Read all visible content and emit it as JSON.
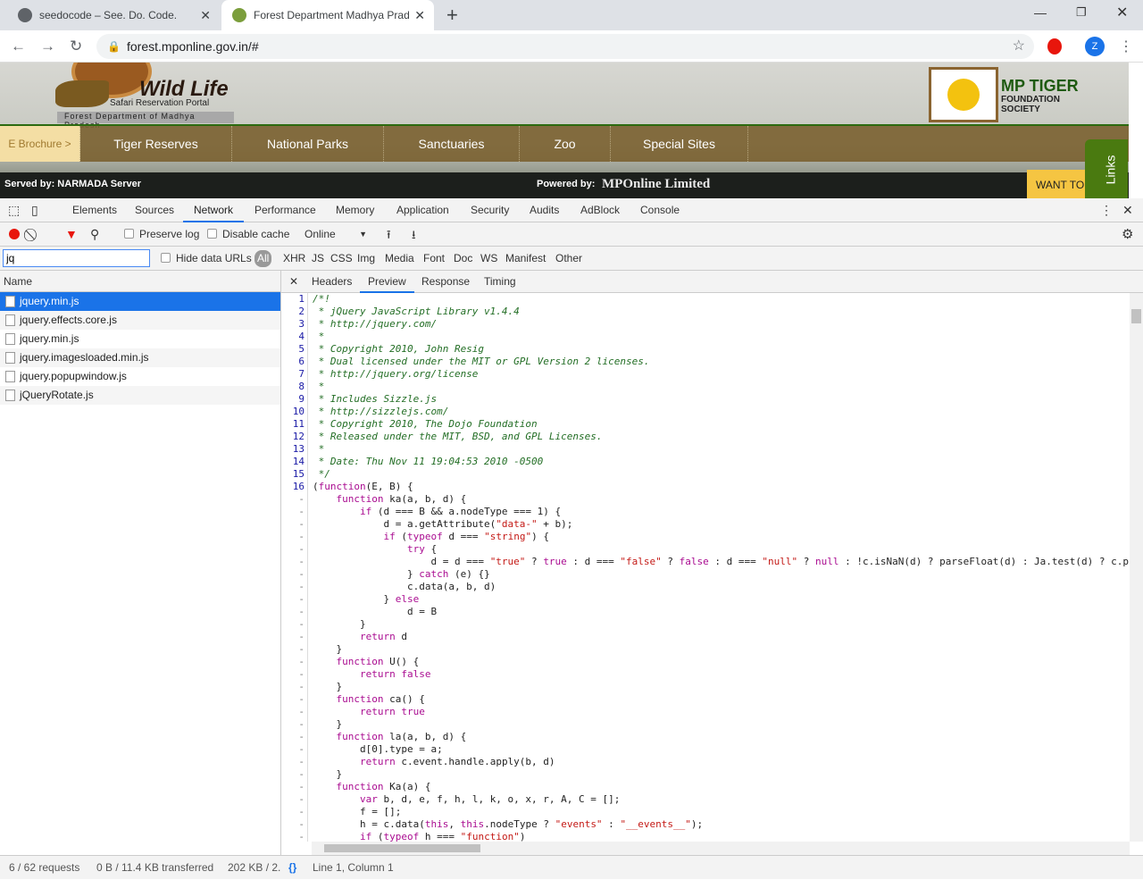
{
  "browser": {
    "tabs": [
      {
        "title": "seedocode – See. Do. Code."
      },
      {
        "title": "Forest Department Madhya Prad"
      }
    ],
    "url": "forest.mponline.gov.in/#",
    "profile": "Z"
  },
  "site": {
    "logo_title": "Wild Life",
    "logo_sub": "Safari Reservation Portal",
    "dept": "Forest Department of Madhya Pradesh",
    "tiger_title": "MP TIGER",
    "tiger_sub1": "FOUNDATION",
    "tiger_sub2": "SOCIETY",
    "nav": [
      "E Brochure >",
      "Tiger Reserves",
      "National Parks",
      "Sanctuaries",
      "Zoo",
      "Special Sites"
    ],
    "served": "Served by: NARMADA Server",
    "powered": "Powered by:",
    "powered_logo": "MPOnline Limited",
    "want": "WANT TO",
    "links": "Links"
  },
  "devtools": {
    "tabs": [
      "Elements",
      "Sources",
      "Network",
      "Performance",
      "Memory",
      "Application",
      "Security",
      "Audits",
      "AdBlock",
      "Console"
    ],
    "active_tab": "Network",
    "toolbar": {
      "preserve_log": "Preserve log",
      "disable_cache": "Disable cache",
      "throttle": "Online"
    },
    "filter": {
      "value": "jq",
      "hide_data_urls": "Hide data URLs",
      "types": [
        "All",
        "XHR",
        "JS",
        "CSS",
        "Img",
        "Media",
        "Font",
        "Doc",
        "WS",
        "Manifest",
        "Other"
      ]
    },
    "name_header": "Name",
    "files": [
      "jquery.min.js",
      "jquery.effects.core.js",
      "jquery.min.js",
      "jquery.imagesloaded.min.js",
      "jquery.popupwindow.js",
      "jQueryRotate.js"
    ],
    "detail_tabs": [
      "Headers",
      "Preview",
      "Response",
      "Timing"
    ],
    "code": [
      [
        "1",
        "/*!"
      ],
      [
        "2",
        " * jQuery JavaScript Library v1.4.4"
      ],
      [
        "3",
        " * http://jquery.com/"
      ],
      [
        "4",
        " *"
      ],
      [
        "5",
        " * Copyright 2010, John Resig"
      ],
      [
        "6",
        " * Dual licensed under the MIT or GPL Version 2 licenses."
      ],
      [
        "7",
        " * http://jquery.org/license"
      ],
      [
        "8",
        " *"
      ],
      [
        "9",
        " * Includes Sizzle.js"
      ],
      [
        "10",
        " * http://sizzlejs.com/"
      ],
      [
        "11",
        " * Copyright 2010, The Dojo Foundation"
      ],
      [
        "12",
        " * Released under the MIT, BSD, and GPL Licenses."
      ],
      [
        "13",
        " *"
      ],
      [
        "14",
        " * Date: Thu Nov 11 19:04:53 2010 -0500"
      ],
      [
        "15",
        " */"
      ],
      [
        "16",
        "(function(E, B) {"
      ],
      [
        "-",
        "    function ka(a, b, d) {"
      ],
      [
        "-",
        "        if (d === B && a.nodeType === 1) {"
      ],
      [
        "-",
        "            d = a.getAttribute(\"data-\" + b);"
      ],
      [
        "-",
        "            if (typeof d === \"string\") {"
      ],
      [
        "-",
        "                try {"
      ],
      [
        "-",
        "                    d = d === \"true\" ? true : d === \"false\" ? false : d === \"null\" ? null : !c.isNaN(d) ? parseFloat(d) : Ja.test(d) ? c.p"
      ],
      [
        "-",
        "                } catch (e) {}"
      ],
      [
        "-",
        "                c.data(a, b, d)"
      ],
      [
        "-",
        "            } else"
      ],
      [
        "-",
        "                d = B"
      ],
      [
        "-",
        "        }"
      ],
      [
        "-",
        "        return d"
      ],
      [
        "-",
        "    }"
      ],
      [
        "-",
        "    function U() {"
      ],
      [
        "-",
        "        return false"
      ],
      [
        "-",
        "    }"
      ],
      [
        "-",
        "    function ca() {"
      ],
      [
        "-",
        "        return true"
      ],
      [
        "-",
        "    }"
      ],
      [
        "-",
        "    function la(a, b, d) {"
      ],
      [
        "-",
        "        d[0].type = a;"
      ],
      [
        "-",
        "        return c.event.handle.apply(b, d)"
      ],
      [
        "-",
        "    }"
      ],
      [
        "-",
        "    function Ka(a) {"
      ],
      [
        "-",
        "        var b, d, e, f, h, l, k, o, x, r, A, C = [];"
      ],
      [
        "-",
        "        f = [];"
      ],
      [
        "-",
        "        h = c.data(this, this.nodeType ? \"events\" : \"__events__\");"
      ],
      [
        "-",
        "        if (typeof h === \"function\")"
      ]
    ],
    "status": {
      "requests": "6 / 62 requests",
      "transferred": "0 B / 11.4 KB transferred",
      "size": "202 KB / 2.",
      "position": "Line 1, Column 1"
    }
  },
  "colors": {
    "accent": "#1a73e8",
    "nav_bg": "#7a6030",
    "record": "#e8160c"
  }
}
